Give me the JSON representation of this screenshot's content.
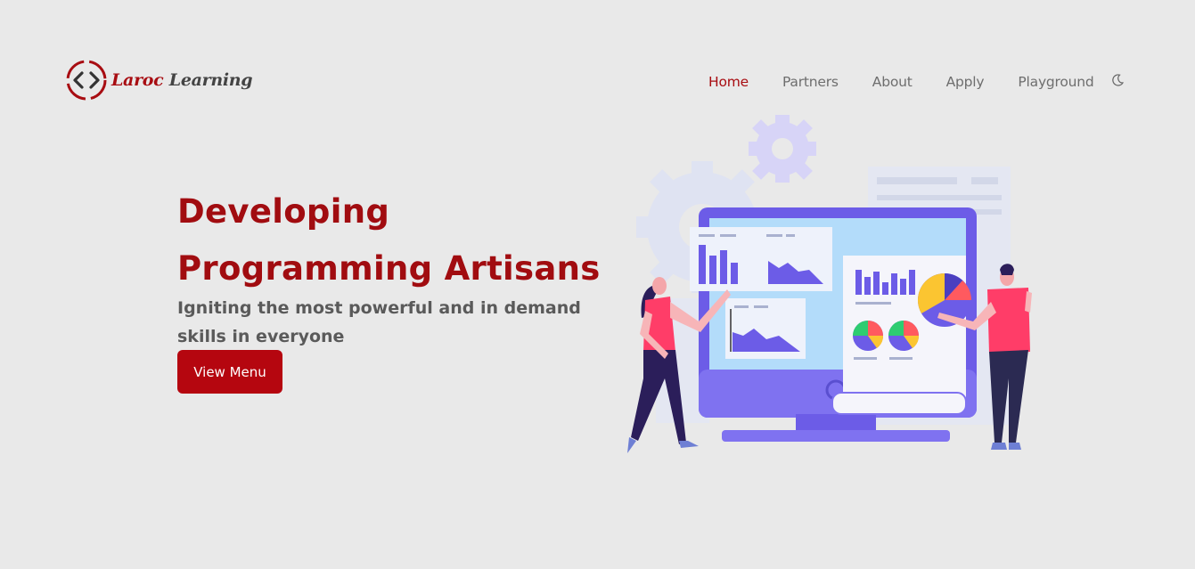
{
  "brand": {
    "name_part1": "Laroc",
    "name_part2": "Learning",
    "logo_glyph": "<>"
  },
  "nav": {
    "items": [
      {
        "label": "Home",
        "active": true
      },
      {
        "label": "Partners",
        "active": false
      },
      {
        "label": "About",
        "active": false
      },
      {
        "label": "Apply",
        "active": false
      },
      {
        "label": "Playground",
        "active": false
      }
    ],
    "theme_toggle_icon": "moon-icon"
  },
  "hero": {
    "title_line1": "Developing",
    "title_line2": "Programming Artisans",
    "subtitle": "Igniting the most powerful and in demand skills in everyone",
    "cta_label": "View Menu"
  },
  "colors": {
    "accent": "#a80d12",
    "button": "#b5060f",
    "background": "#e9e9e9",
    "illustration_primary": "#6c5ce7"
  }
}
